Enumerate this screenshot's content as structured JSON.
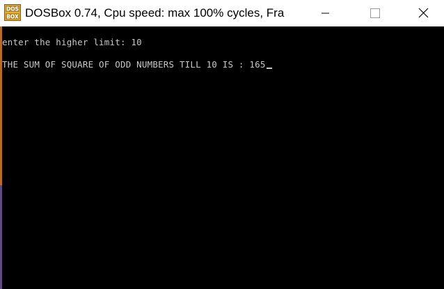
{
  "window": {
    "title": "DOSBox 0.74, Cpu speed: max 100% cycles, Fra",
    "icon": "dosbox-app-icon",
    "icon_text_top": "DOS",
    "icon_text_bottom": "BOX",
    "controls": [
      "minimize-icon",
      "maximize-icon",
      "close-icon"
    ]
  },
  "console": {
    "lines": [
      "enter the higher limit: 10",
      "THE SUM OF SQUARE OF ODD NUMBERS TILL 10 IS : 165"
    ],
    "text_color": "#c8c8c8",
    "background": "#000000"
  }
}
